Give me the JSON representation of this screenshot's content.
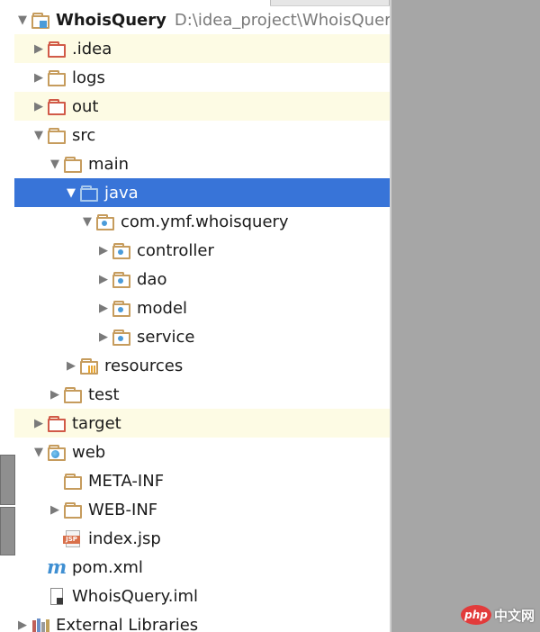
{
  "project_tree": {
    "root": {
      "label": "WhoisQuery",
      "path": "D:\\idea_project\\WhoisQuery"
    },
    "items": [
      {
        "label": ".idea",
        "arrow": "▶"
      },
      {
        "label": "logs",
        "arrow": "▶"
      },
      {
        "label": "out",
        "arrow": "▶"
      },
      {
        "label": "src",
        "arrow": "▼"
      },
      {
        "label": "main",
        "arrow": "▼"
      },
      {
        "label": "java",
        "arrow": "▼"
      },
      {
        "label": "com.ymf.whoisquery",
        "arrow": "▼"
      },
      {
        "label": "controller",
        "arrow": "▶"
      },
      {
        "label": "dao",
        "arrow": "▶"
      },
      {
        "label": "model",
        "arrow": "▶"
      },
      {
        "label": "service",
        "arrow": "▶"
      },
      {
        "label": "resources",
        "arrow": "▶"
      },
      {
        "label": "test",
        "arrow": "▶"
      },
      {
        "label": "target",
        "arrow": "▶"
      },
      {
        "label": "web",
        "arrow": "▼"
      },
      {
        "label": "META-INF",
        "arrow": ""
      },
      {
        "label": "WEB-INF",
        "arrow": "▶"
      },
      {
        "label": "index.jsp",
        "arrow": ""
      },
      {
        "label": "pom.xml",
        "arrow": ""
      },
      {
        "label": "WhoisQuery.iml",
        "arrow": ""
      },
      {
        "label": "External Libraries",
        "arrow": "▶"
      }
    ],
    "root_arrow": "▼",
    "selected_item": "java",
    "jsp_tag": "JSP",
    "maven_glyph": "m"
  },
  "colors": {
    "selection": "#3874d8",
    "excluded_folder": "#d15a48",
    "folder": "#c69c5d",
    "excluded_row_bg": "#fdfbe4"
  },
  "watermark": {
    "logo": "php",
    "text": "中文网"
  }
}
